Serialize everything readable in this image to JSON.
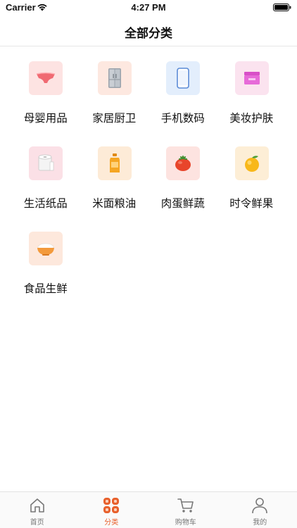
{
  "status_bar": {
    "carrier": "Carrier",
    "time": "4:27 PM"
  },
  "nav": {
    "title": "全部分类"
  },
  "categories": [
    {
      "label": "母婴用品",
      "icon": "diaper-icon",
      "bg": "#fde3e2"
    },
    {
      "label": "家居厨卫",
      "icon": "fridge-icon",
      "bg": "#fde8e0"
    },
    {
      "label": "手机数码",
      "icon": "phone-icon",
      "bg": "#e3eefc"
    },
    {
      "label": "美妆护肤",
      "icon": "cosmetics-icon",
      "bg": "#fbe3ef"
    },
    {
      "label": "生活纸品",
      "icon": "toilet-paper-icon",
      "bg": "#fbe0e6"
    },
    {
      "label": "米面粮油",
      "icon": "oil-bottle-icon",
      "bg": "#fdebd7"
    },
    {
      "label": "肉蛋鲜蔬",
      "icon": "tomato-icon",
      "bg": "#fde3e0"
    },
    {
      "label": "时令鲜果",
      "icon": "orange-icon",
      "bg": "#fdeed6"
    },
    {
      "label": "食品生鲜",
      "icon": "rice-bowl-icon",
      "bg": "#fde8dc"
    }
  ],
  "tabs": [
    {
      "label": "首页",
      "icon": "home-icon",
      "active": false
    },
    {
      "label": "分类",
      "icon": "category-icon",
      "active": true
    },
    {
      "label": "购物车",
      "icon": "cart-icon",
      "active": false
    },
    {
      "label": "我的",
      "icon": "user-icon",
      "active": false
    }
  ],
  "colors": {
    "accent": "#e8602c",
    "inactive": "#777777"
  }
}
